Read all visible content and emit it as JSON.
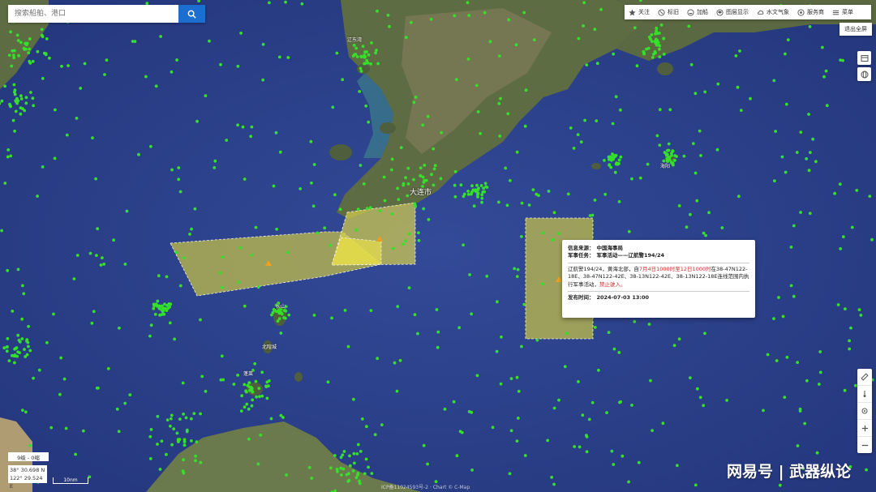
{
  "search": {
    "placeholder": "搜索船舶、港口"
  },
  "toolbar": {
    "items": [
      {
        "label": "关注",
        "icon": "star-icon"
      },
      {
        "label": "标旧",
        "icon": "tag-icon"
      },
      {
        "label": "加船",
        "icon": "ship-icon"
      },
      {
        "label": "图层显示",
        "icon": "layers-icon"
      },
      {
        "label": "水文气象",
        "icon": "weather-icon"
      },
      {
        "label": "服务商",
        "icon": "service-icon"
      },
      {
        "label": "菜单",
        "icon": "menu-icon"
      }
    ],
    "exit_fullscreen": "退出全屏"
  },
  "popup": {
    "source_label": "信息来源：",
    "source_value": "中国海事局",
    "task_label": "军事任务：",
    "task_value": "军事活动——辽航警194/24",
    "body_before": "辽航警194/24，黄海北部，自",
    "body_time": "7月4日1000时至12日1000时",
    "body_mid": "在38-47N122-18E、38-47N122-42E、38-13N122-42E、38-13N122-18E连线范围内执行军事活动，",
    "body_prohibit": "禁止驶入。",
    "publish_label": "发布时间：",
    "publish_value": "2024-07-03 13:00"
  },
  "map_labels": {
    "dalian": "大连市",
    "liaodong_bay": "辽东湾",
    "beihuangcheng": "北隍城",
    "changshan": "长山",
    "haiyang": "海阳",
    "penglai": "蓬莱"
  },
  "status": {
    "zoom_level": "9级 - 0缩",
    "lat": "38° 30.698 N",
    "lon": "122° 29.524 E",
    "scale": "10nm"
  },
  "watermark": "网易号 | 武器纵论",
  "footer": "ICP备11024593号-2 · Chart © C-Map",
  "colors": {
    "sea": "#2b3f8a",
    "land": "#6b7a4d",
    "ship": "#35e02a",
    "zone": "#c8c447",
    "accent": "#1c6fd1",
    "warning": "#d42a2a"
  }
}
